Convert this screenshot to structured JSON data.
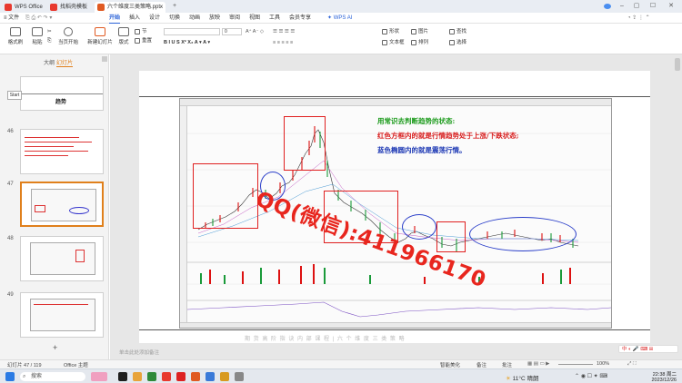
{
  "titlebar": {
    "tabs": [
      {
        "label": "WPS Office"
      },
      {
        "label": "找稻壳模板"
      },
      {
        "label": "六个维度三类策略.pptx"
      }
    ],
    "add_tab": "+",
    "wps_ai": "WPS AI"
  },
  "menubar": {
    "file": "文件",
    "items": [
      "开始",
      "插入",
      "设计",
      "切换",
      "动画",
      "放映",
      "审阅",
      "视图",
      "工具",
      "会员专享"
    ],
    "active": "开始"
  },
  "ribbon": {
    "format_painter": "格式刷",
    "paste": "粘贴",
    "play_from_current": "当页开始",
    "new_slide": "新建幻灯片",
    "layout": "版式",
    "section": "节",
    "reset": "重置",
    "font_size_value": "0",
    "shapes": "形状",
    "picture": "图片",
    "textbox": "文本框",
    "arrange": "排列",
    "find": "查找",
    "select": "选择"
  },
  "leftpanel": {
    "tab_outline": "大纲",
    "tab_slides": "幻灯片",
    "slide_numbers": [
      "46",
      "47",
      "48",
      "49"
    ],
    "thumb_title": "趋势",
    "start_btn": "Start",
    "add_slide": "+"
  },
  "slide": {
    "line1": "用常识去判断趋势的状态:",
    "line2": "红色方框内的就是行情趋势处于上涨/下跌状态;",
    "line3": "蓝色椭圆内的就是震荡行情。",
    "watermark": "QQ(微信):411966170",
    "footer": "期 货 高 阶 指 诀 内 部 课 程 | 六 个 维 度 三 类 策 略"
  },
  "notes": {
    "placeholder": "单击此处添加备注"
  },
  "statusbar": {
    "slide_counter": "幻灯片 47 / 119",
    "theme": "Office 主题",
    "smart_beautify": "智能美化",
    "notes_btn": "备注",
    "comments_btn": "批注",
    "zoom": "100%"
  },
  "taskbar": {
    "search_placeholder": "搜索",
    "weather_temp": "11°C",
    "weather_text": "晴朗",
    "time": "22:38 周二",
    "date": "2023/12/26"
  },
  "colors": {
    "accent": "#2a62d8",
    "selection": "#e0801c",
    "red_box": "#e02020",
    "blue_ellipse": "#2b3fc9",
    "text_green": "#1a9a1a",
    "text_red": "#d81e1e",
    "text_blue": "#1f3ab5"
  }
}
